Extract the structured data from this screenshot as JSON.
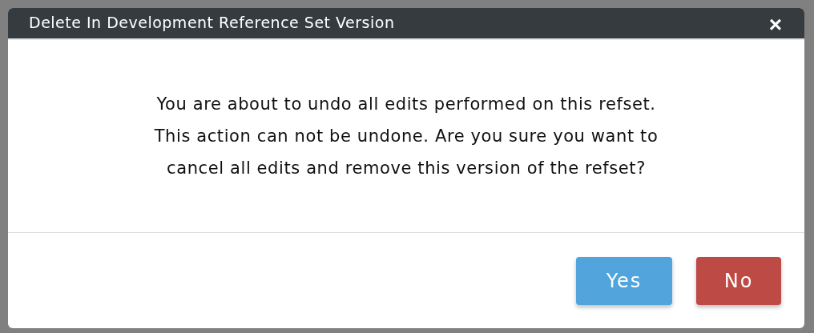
{
  "dialog": {
    "title": "Delete In Development Reference Set Version",
    "close": "×",
    "message": "You are about to undo all edits performed on this refset. This action can not be undone. Are you sure you want to cancel all edits and remove this version of the refset?",
    "buttons": [
      {
        "label": "Yes",
        "kind": "confirm"
      },
      {
        "label": "No",
        "kind": "cancel"
      }
    ]
  }
}
